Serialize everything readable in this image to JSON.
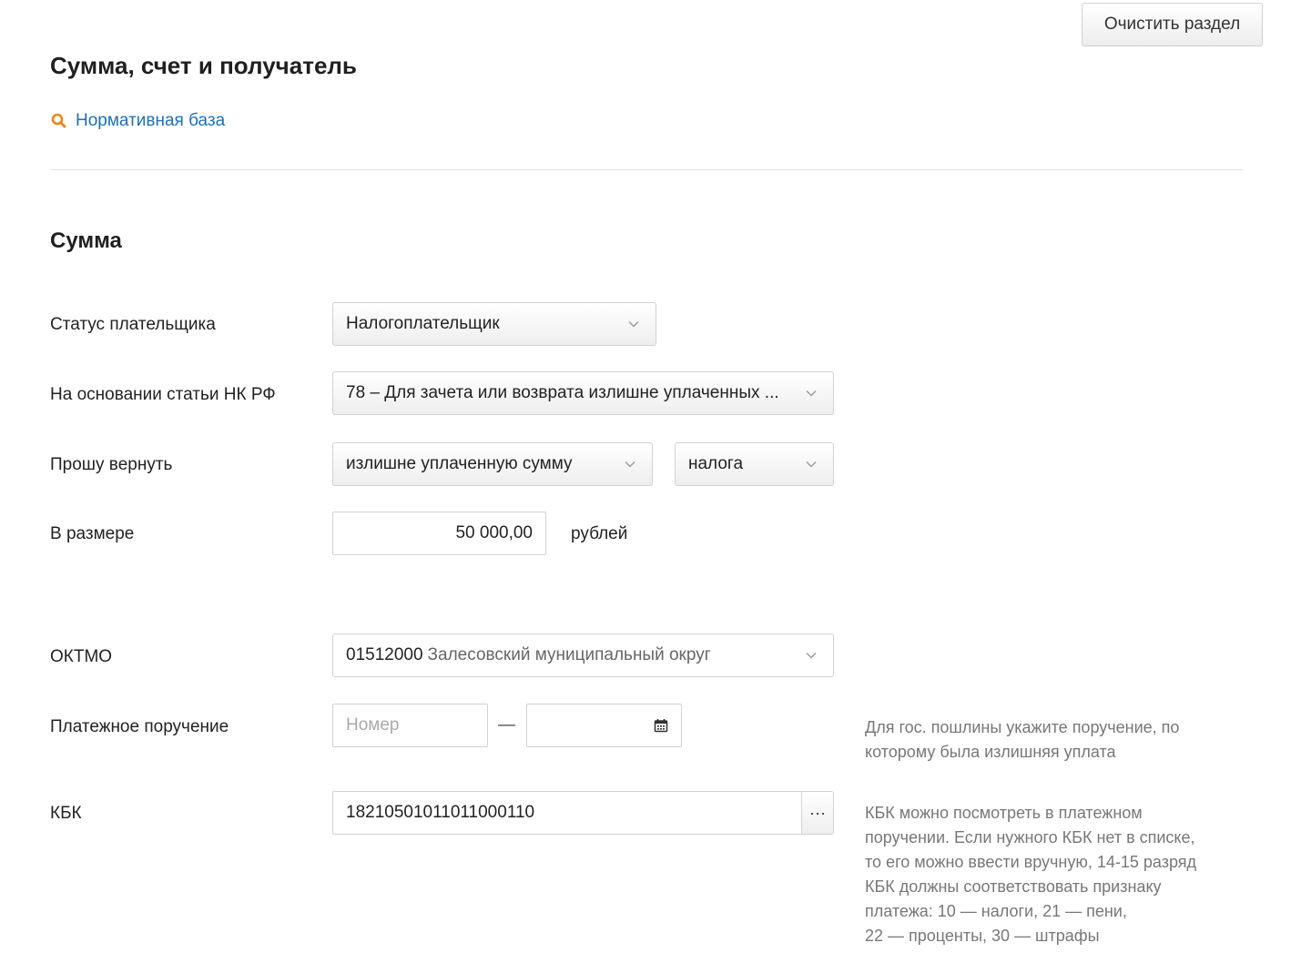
{
  "header": {
    "clear_button": "Очистить раздел",
    "title": "Сумма, счет и получатель",
    "norm_link": "Нормативная база",
    "norm_icon": "search-icon",
    "accent_color": "#f0841e",
    "link_color": "#1e6fb5"
  },
  "section": {
    "title": "Сумма"
  },
  "form": {
    "payer_status": {
      "label": "Статус плательщика",
      "value": "Налогоплательщик"
    },
    "article": {
      "label": "На основании статьи НК РФ",
      "value": "78 – Для зачета или возврата излишне уплаченных ..."
    },
    "refund": {
      "label": "Прошу вернуть",
      "what": "излишне уплаченную сумму",
      "of": "налога"
    },
    "amount": {
      "label": "В размере",
      "value": "50 000,00",
      "unit": "рублей"
    },
    "oktmo": {
      "label": "ОКТМО",
      "code": "01512000",
      "name": "Залесовский муниципальный округ"
    },
    "payment_order": {
      "label": "Платежное поручение",
      "number_placeholder": "Номер",
      "separator": "—",
      "hint": "Для гос. пошлины укажите поручение, по которому была излишняя уплата"
    },
    "kbk": {
      "label": "КБК",
      "value": "18210501011011000110",
      "button": "···",
      "hint_lines": [
        "КБК можно посмотреть в платежном",
        "поручении. Если нужного КБК нет в списке,",
        "то его можно ввести вручную, 14-15 разряд",
        "КБК должны соответствовать признаку",
        "платежа: 10 — налоги, 21 — пени,",
        "22 — проценты, 30 — штрафы"
      ]
    }
  }
}
